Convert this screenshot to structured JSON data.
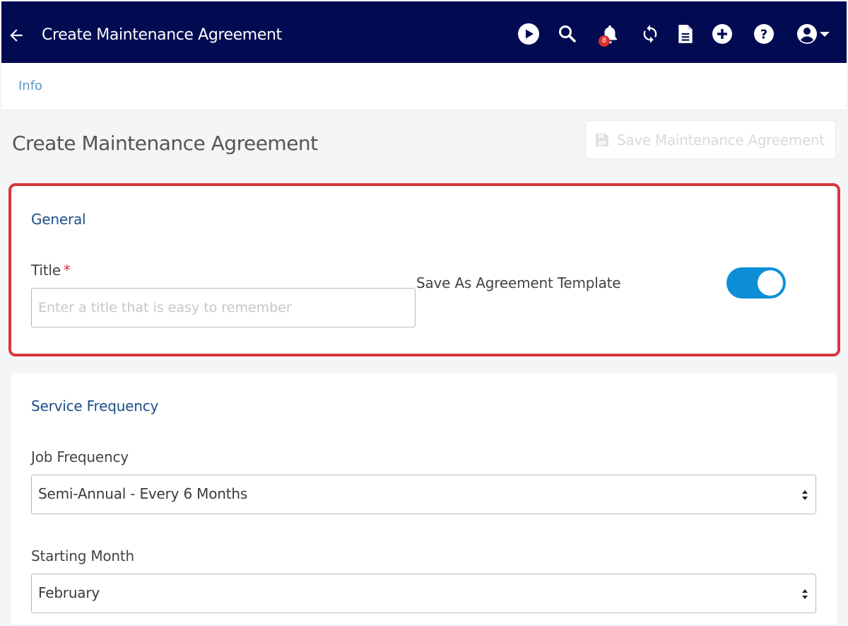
{
  "header": {
    "title": "Create Maintenance Agreement",
    "notification_count": "8",
    "icons": [
      "back-arrow-icon",
      "play-icon",
      "search-icon",
      "bell-icon",
      "sync-icon",
      "document-icon",
      "plus-circle-icon",
      "help-icon",
      "user-account-icon",
      "caret-down-icon"
    ]
  },
  "tabs": [
    {
      "label": "Info"
    }
  ],
  "page": {
    "title": "Create Maintenance Agreement",
    "save_button_label": "Save Maintenance Agreement",
    "save_button_icon": "floppy-disk-icon"
  },
  "general": {
    "section_title": "General",
    "title_label": "Title",
    "required_marker": "*",
    "title_value": "",
    "title_placeholder": "Enter a title that is easy to remember",
    "template_label": "Save As Agreement Template",
    "template_enabled": true
  },
  "service_frequency": {
    "section_title": "Service Frequency",
    "job_frequency_label": "Job Frequency",
    "job_frequency_value": "Semi-Annual - Every 6 Months",
    "starting_month_label": "Starting Month",
    "starting_month_value": "February"
  },
  "colors": {
    "header_bg": "#020b52",
    "section_title": "#1d4f8a",
    "toggle_on": "#0d8fd8",
    "highlight_border": "#d6373b",
    "tab_link": "#5b9ac2"
  }
}
